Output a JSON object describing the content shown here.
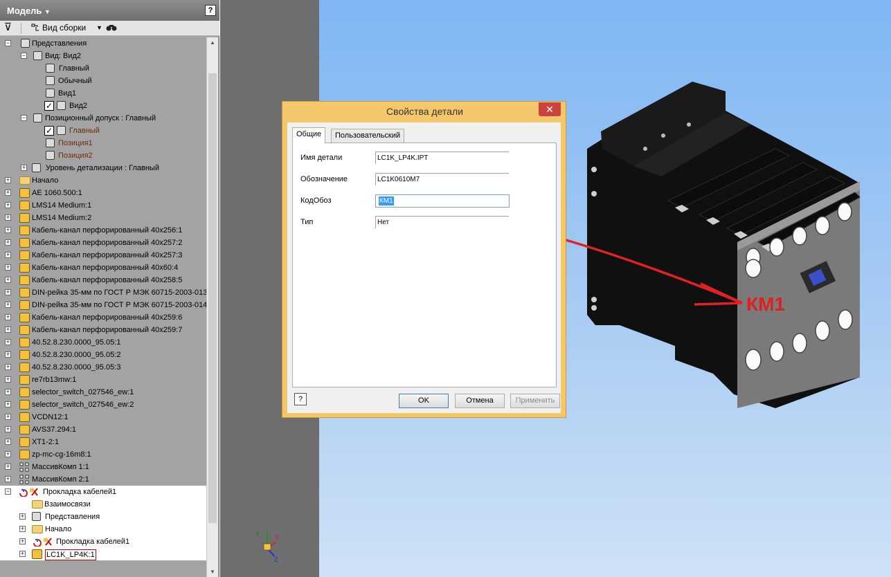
{
  "browser": {
    "title": "Модель",
    "title_arrow": "▼",
    "help": "?",
    "toolbar": {
      "filter": "⊽",
      "view_label": "Вид сборки",
      "dropdown": "▼",
      "find": "⚲"
    }
  },
  "tree": {
    "items": [
      {
        "label": "Представления"
      },
      {
        "label": "Вид: Вид2"
      },
      {
        "label": "Главный"
      },
      {
        "label": "Обычный"
      },
      {
        "label": "Вид1"
      },
      {
        "label": "Вид2"
      },
      {
        "label": "Позиционный допуск : Главный"
      },
      {
        "label": "Главный"
      },
      {
        "label": "Позиция1"
      },
      {
        "label": "Позиция2"
      },
      {
        "label": "Уровень детализации : Главный"
      },
      {
        "label": "Начало"
      },
      {
        "label": "AE 1060.500:1"
      },
      {
        "label": "LMS14 Medium:1"
      },
      {
        "label": "LMS14 Medium:2"
      },
      {
        "label": "Кабель-канал перфорированный 40x256:1"
      },
      {
        "label": "Кабель-канал перфорированный 40x257:2"
      },
      {
        "label": "Кабель-канал перфорированный 40x257:3"
      },
      {
        "label": "Кабель-канал перфорированный 40x60:4"
      },
      {
        "label": "Кабель-канал перфорированный 40x258:5"
      },
      {
        "label": "DIN-рейка 35-мм по ГОСТ Р МЭК 60715-2003-013:"
      },
      {
        "label": "DIN-рейка 35-мм по ГОСТ Р МЭК 60715-2003-014:"
      },
      {
        "label": "Кабель-канал перфорированный 40x259:6"
      },
      {
        "label": "Кабель-канал перфорированный 40x259:7"
      },
      {
        "label": "40.52.8.230.0000_95.05:1"
      },
      {
        "label": "40.52.8.230.0000_95.05:2"
      },
      {
        "label": "40.52.8.230.0000_95.05:3"
      },
      {
        "label": "re7rb13mw:1"
      },
      {
        "label": "selector_switch_027546_ew:1"
      },
      {
        "label": "selector_switch_027546_ew:2"
      },
      {
        "label": "VCDN12:1"
      },
      {
        "label": "AVS37.294:1"
      },
      {
        "label": "XT1-2:1"
      },
      {
        "label": "zp-mc-cg-16m8:1"
      },
      {
        "label": "МассивКомп 1:1"
      },
      {
        "label": "МассивКомп 2:1"
      },
      {
        "label": "Прокладка кабелей1"
      },
      {
        "label": "Взаимосвязи"
      },
      {
        "label": "Представления"
      },
      {
        "label": "Начало"
      },
      {
        "label": "Прокладка кабелей1"
      },
      {
        "label": "LC1K_LP4K:1"
      }
    ]
  },
  "triad": {
    "x": "X",
    "y": "Y",
    "z": "Z"
  },
  "dialog": {
    "title": "Свойства детали",
    "close": "✕",
    "tabs": [
      "Общие",
      "Пользовательский"
    ],
    "props": [
      {
        "label": "Имя детали",
        "value": "LC1K_LP4K.IPT"
      },
      {
        "label": "Обозначение",
        "value": "LC1K0610M7"
      },
      {
        "label": "КодОбоз",
        "value": "КМ1"
      },
      {
        "label": "Тип",
        "value": "Нет"
      }
    ],
    "help": "?",
    "buttons": {
      "ok": "OK",
      "cancel": "Отмена",
      "apply": "Применить"
    }
  },
  "annotation": {
    "label": "КМ1",
    "color": "#e01f1f"
  },
  "colors": {
    "panel": "#a3a3a3",
    "viewport_top": "#7fb6f4",
    "viewport_bottom": "#cfe1f6",
    "dialog_frame": "#f4c86a"
  }
}
